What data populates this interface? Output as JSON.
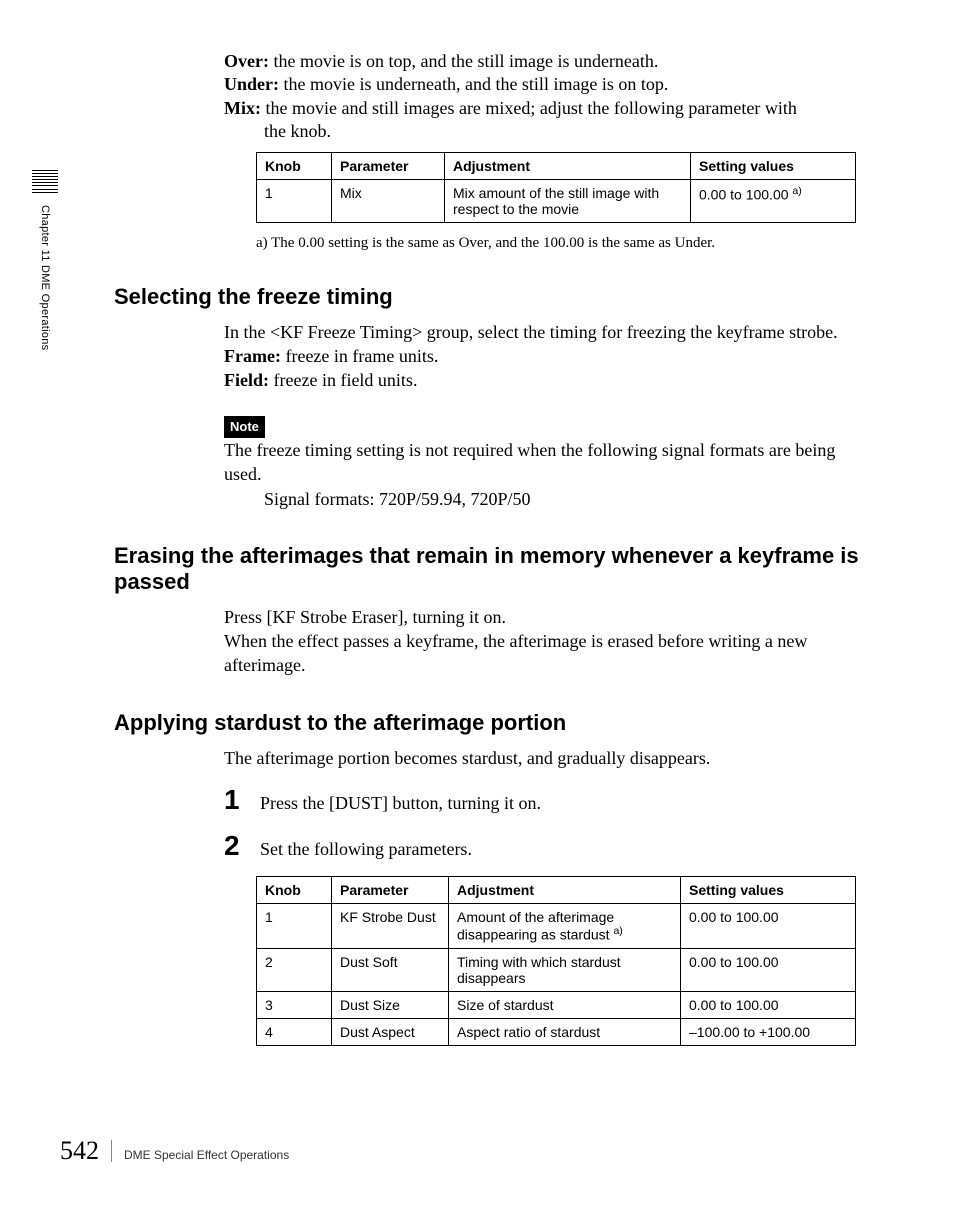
{
  "side": {
    "chapter": "Chapter 11  DME Operations"
  },
  "definitions": {
    "over": {
      "label": "Over:",
      "text": " the movie is on top, and the still image is underneath."
    },
    "under": {
      "label": "Under:",
      "text": " the movie is underneath, and the still image is on top."
    },
    "mix": {
      "label": "Mix:",
      "text": " the movie and still images are mixed; adjust the following parameter with",
      "text2": "the knob."
    }
  },
  "table1": {
    "headers": {
      "knob": "Knob",
      "parameter": "Parameter",
      "adjustment": "Adjustment",
      "setting": "Setting values"
    },
    "rows": [
      {
        "knob": "1",
        "parameter": "Mix",
        "adjustment": "Mix amount of the still image with respect to the movie",
        "setting": "0.00 to 100.00 ",
        "note": "a)"
      }
    ],
    "footnote": "a) The 0.00 setting is the same as Over, and the 100.00 is the same as Under."
  },
  "sect1": {
    "title": "Selecting the freeze timing",
    "intro": "In the <KF Freeze Timing> group, select the timing for freezing the keyframe strobe.",
    "frame": {
      "label": "Frame:",
      "text": " freeze in frame units."
    },
    "field": {
      "label": "Field:",
      "text": " freeze in field units."
    },
    "note_label": "Note",
    "note_body": "The freeze timing setting is not required when the following signal formats are being used.",
    "note_formats": "Signal formats: 720P/59.94, 720P/50"
  },
  "sect2": {
    "title": "Erasing the afterimages that remain in memory whenever a keyframe is passed",
    "p1": "Press [KF Strobe Eraser], turning it on.",
    "p2": "When the effect passes a keyframe, the afterimage is erased before writing a new afterimage."
  },
  "sect3": {
    "title": "Applying stardust to the afterimage portion",
    "intro": "The afterimage portion becomes stardust, and gradually disappears.",
    "step1_num": "1",
    "step1": "Press the [DUST] button, turning it on.",
    "step2_num": "2",
    "step2": "Set the following parameters."
  },
  "table2": {
    "headers": {
      "knob": "Knob",
      "parameter": "Parameter",
      "adjustment": "Adjustment",
      "setting": "Setting values"
    },
    "rows": [
      {
        "knob": "1",
        "parameter": "KF Strobe Dust",
        "adjustment": "Amount of the afterimage disappearing as stardust ",
        "note": "a)",
        "setting": "0.00 to 100.00"
      },
      {
        "knob": "2",
        "parameter": "Dust Soft",
        "adjustment": "Timing with which stardust disappears",
        "note": "",
        "setting": "0.00 to 100.00"
      },
      {
        "knob": "3",
        "parameter": "Dust Size",
        "adjustment": "Size of stardust",
        "note": "",
        "setting": "0.00 to 100.00"
      },
      {
        "knob": "4",
        "parameter": "Dust Aspect",
        "adjustment": "Aspect ratio of stardust",
        "note": "",
        "setting": "–100.00 to +100.00"
      }
    ]
  },
  "footer": {
    "page": "542",
    "section": "DME Special Effect Operations"
  }
}
